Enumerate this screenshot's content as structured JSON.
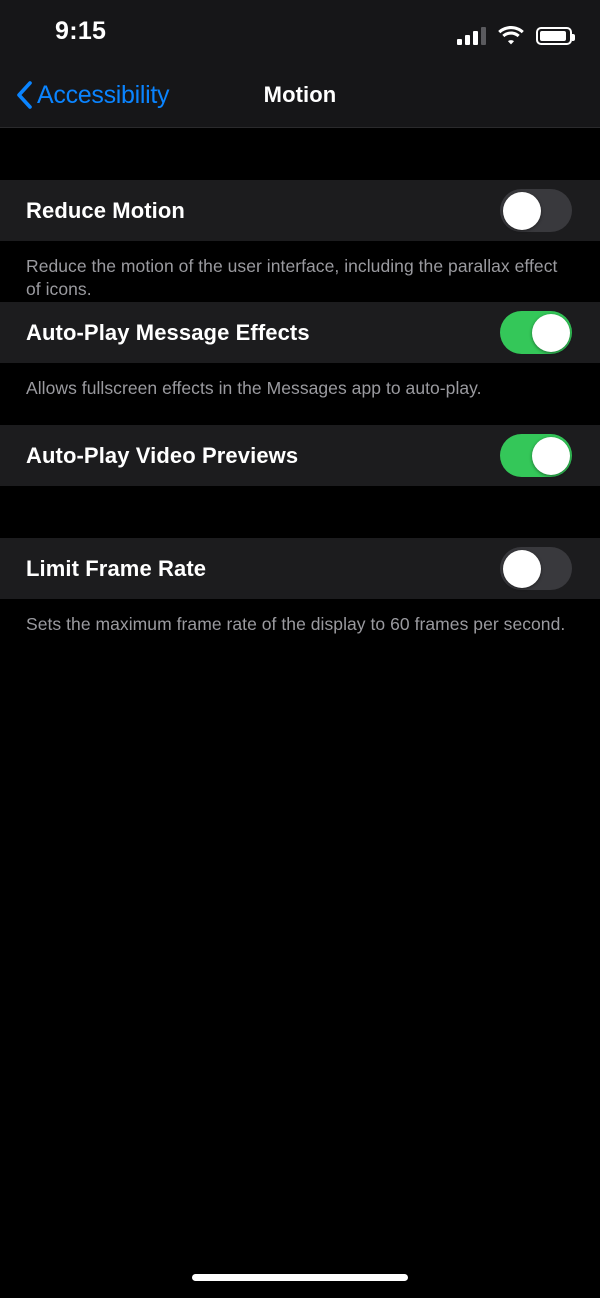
{
  "status_bar": {
    "time": "9:15",
    "cellular_icon": "cellular-signal-icon",
    "cellular_bars_filled": 3,
    "cellular_bars_total": 4,
    "wifi_icon": "wifi-icon",
    "battery_icon": "battery-icon",
    "battery_level_percent": 92
  },
  "nav_bar": {
    "back_icon": "chevron-left-icon",
    "back_label": "Accessibility",
    "title": "Motion",
    "accent_color": "#0a84ff"
  },
  "colors": {
    "page_background": "#000000",
    "row_background": "#1c1c1e",
    "nav_background": "#161618",
    "toggle_on": "#34c759",
    "toggle_off": "#39393d",
    "footer_text": "#9a9a9f",
    "primary_text": "#ffffff"
  },
  "sections": [
    {
      "rows": [
        {
          "label": "Reduce Motion",
          "control": "toggle",
          "value": "off",
          "state_label": "Off"
        }
      ],
      "footer": "Reduce the motion of the user interface, including the parallax effect of icons."
    },
    {
      "rows": [
        {
          "label": "Auto-Play Message Effects",
          "control": "toggle",
          "value": "on",
          "state_label": "On"
        }
      ],
      "footer": "Allows fullscreen effects in the Messages app to auto-play."
    },
    {
      "rows": [
        {
          "label": "Auto-Play Video Previews",
          "control": "toggle",
          "value": "on",
          "state_label": "On"
        }
      ],
      "footer": ""
    },
    {
      "rows": [
        {
          "label": "Limit Frame Rate",
          "control": "toggle",
          "value": "off",
          "state_label": "Off"
        }
      ],
      "footer": "Sets the maximum frame rate of the display to 60 frames per second."
    }
  ],
  "home_indicator": "home-indicator"
}
